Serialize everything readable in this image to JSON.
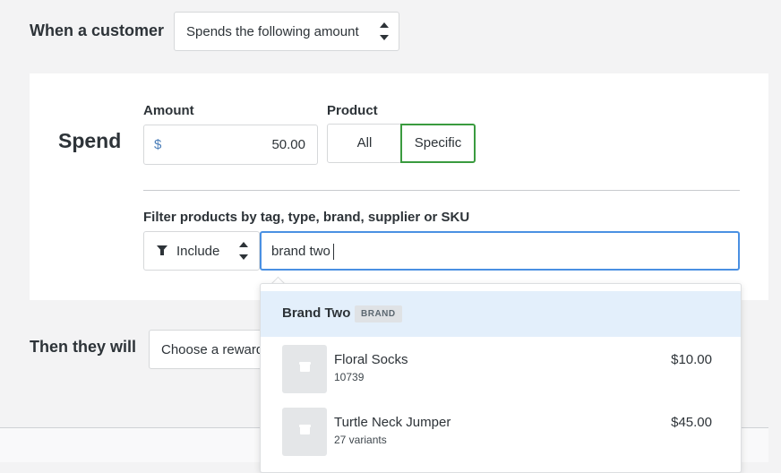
{
  "trigger": {
    "label": "When a customer",
    "select_value": "Spends the following amount"
  },
  "spend": {
    "title": "Spend",
    "amount_label": "Amount",
    "currency": "$",
    "amount_value": "50.00",
    "product_label": "Product",
    "product_options": [
      "All",
      "Specific"
    ],
    "product_selected": "Specific"
  },
  "filter": {
    "label": "Filter products by tag, type, brand, supplier or SKU",
    "mode": "Include",
    "search_value": "brand two"
  },
  "dropdown": {
    "header_name": "Brand Two",
    "header_badge": "BRAND",
    "items": [
      {
        "name": "Floral Socks",
        "sub": "10739",
        "price": "$10.00"
      },
      {
        "name": "Turtle Neck Jumper",
        "sub": "27 variants",
        "price": "$45.00"
      }
    ]
  },
  "then": {
    "label": "Then they will",
    "select_value": "Choose a reward"
  },
  "colors": {
    "accent_focus": "#4a90e2",
    "selected_green": "#3a9b3f",
    "highlight_row": "#e3effb"
  }
}
